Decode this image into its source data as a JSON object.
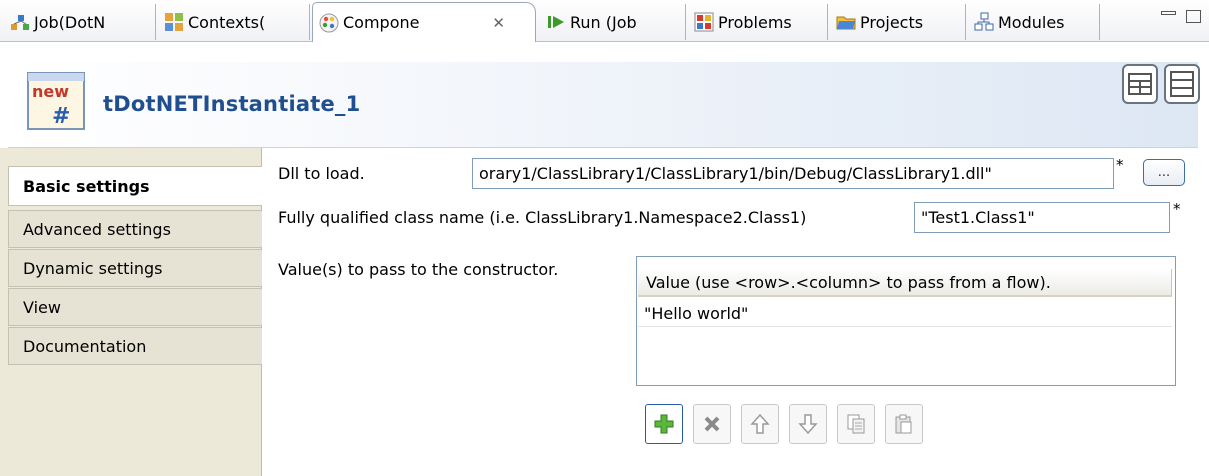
{
  "tabs": [
    {
      "label": "Job(DotN",
      "icon": "job-icon"
    },
    {
      "label": "Contexts(",
      "icon": "contexts-icon"
    },
    {
      "label": "Compone",
      "icon": "component-icon",
      "active": true
    },
    {
      "label": "Run (Job",
      "icon": "run-icon"
    },
    {
      "label": "Problems",
      "icon": "problems-icon"
    },
    {
      "label": "Projects",
      "icon": "projects-icon"
    },
    {
      "label": "Modules",
      "icon": "modules-icon"
    }
  ],
  "header": {
    "title": "tDotNETInstantiate_1",
    "icon_badge": "new"
  },
  "sidebar": {
    "items": [
      {
        "label": "Basic settings",
        "active": true
      },
      {
        "label": "Advanced settings"
      },
      {
        "label": "Dynamic settings"
      },
      {
        "label": "View"
      },
      {
        "label": "Documentation"
      }
    ]
  },
  "form": {
    "dll_label": "Dll to load.",
    "dll_value": "orary1/ClassLibrary1/ClassLibrary1/bin/Debug/ClassLibrary1.dll\"",
    "dll_required": "*",
    "browse_label": "...",
    "class_label": "Fully qualified class name (i.e. ClassLibrary1.Namespace2.Class1)",
    "class_value": "\"Test1.Class1\"",
    "class_required": "*",
    "values_label": "Value(s) to pass to the constructor.",
    "table": {
      "column_header": "Value (use <row>.<column> to pass from a flow).",
      "rows": [
        "\"Hello world\""
      ]
    }
  },
  "colors": {
    "accent": "#1f4f8f",
    "sidebar_bg": "#ece9d8",
    "add_green": "#3c9a2a"
  }
}
